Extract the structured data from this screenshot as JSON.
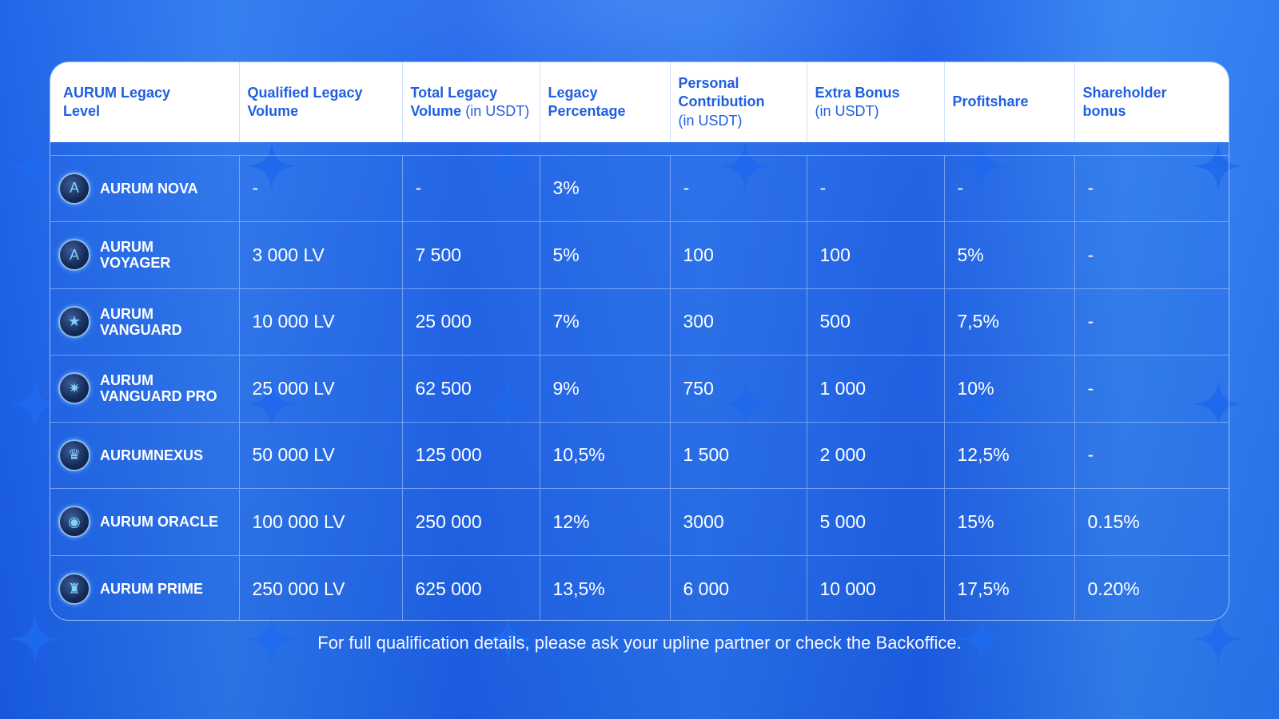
{
  "header": {
    "col_level": [
      "AURUM Legacy",
      "Level"
    ],
    "col_qualified": [
      "Qualified Legacy",
      "Volume"
    ],
    "col_total": [
      "Total Legacy",
      "Volume",
      "(in USDT)"
    ],
    "col_percentage": [
      "Legacy",
      "Percentage"
    ],
    "col_personal": [
      "Personal",
      "Contribution",
      "(in USDT)"
    ],
    "col_extra": [
      "Extra Bonus",
      "(in USDT)"
    ],
    "col_profitshare": "Profitshare",
    "col_shareholder": [
      "Shareholder",
      "bonus"
    ]
  },
  "rows": [
    {
      "icon": "shield-a-icon",
      "level": "AURUM NOVA",
      "qualified": "-",
      "total": "-",
      "percentage": "3%",
      "personal": "-",
      "extra": "-",
      "profitshare": "-",
      "shareholder": "-"
    },
    {
      "icon": "shield-a-icon",
      "level": "AURUM VOYAGER",
      "qualified": "3 000 LV",
      "total": "7 500",
      "percentage": "5%",
      "personal": "100",
      "extra": "100",
      "profitshare": "5%",
      "shareholder": "-"
    },
    {
      "icon": "star-icon",
      "level": "AURUM VANGUARD",
      "qualified": "10 000 LV",
      "total": "25 000",
      "percentage": "7%",
      "personal": "300",
      "extra": "500",
      "profitshare": "7,5%",
      "shareholder": "-"
    },
    {
      "icon": "star-burst-icon",
      "level": "AURUM VANGUARD PRO",
      "qualified": "25 000 LV",
      "total": "62 500",
      "percentage": "9%",
      "personal": "750",
      "extra": "1 000",
      "profitshare": "10%",
      "shareholder": "-"
    },
    {
      "icon": "crown-shield-icon",
      "level": "AURUMNEXUS",
      "qualified": "50 000 LV",
      "total": "125 000",
      "percentage": "10,5%",
      "personal": "1 500",
      "extra": "2 000",
      "profitshare": "12,5%",
      "shareholder": "-"
    },
    {
      "icon": "eye-emblem-icon",
      "level": "AURUM ORACLE",
      "qualified": "100 000 LV",
      "total": "250 000",
      "percentage": "12%",
      "personal": "3000",
      "extra": "5 000",
      "profitshare": "15%",
      "shareholder": "0.15%"
    },
    {
      "icon": "trophy-icon",
      "level": "AURUM PRIME",
      "qualified": "250 000 LV",
      "total": "625 000",
      "percentage": "13,5%",
      "personal": "6 000",
      "extra": "10 000",
      "profitshare": "17,5%",
      "shareholder": "0.20%"
    }
  ],
  "footer_note": "For full qualification details, please ask your upline partner or check the Backoffice.",
  "colors": {
    "background": "#1e63ea",
    "header_bg": "#ffffff",
    "header_text": "#1f5fe0",
    "body_text": "#ffffff",
    "sparkle": "#1f6af0"
  }
}
